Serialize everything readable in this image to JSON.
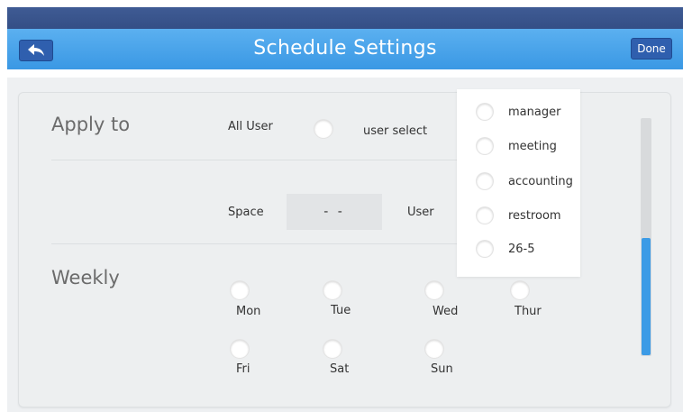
{
  "header": {
    "title": "Schedule Settings",
    "back_icon": "back-arrow-icon",
    "done_label": "Done"
  },
  "apply_to": {
    "label": "Apply to",
    "all_user_label": "All User",
    "user_select_label": "user select"
  },
  "space_user": {
    "space_label": "Space",
    "space_value": "- -",
    "user_label": "User"
  },
  "user_dropdown": {
    "options": [
      "manager",
      "meeting",
      "accounting",
      "restroom",
      "26-5"
    ]
  },
  "weekly": {
    "label": "Weekly",
    "days": [
      "Mon",
      "Tue",
      "Wed",
      "Thur",
      "Fri",
      "Sat",
      "Sun"
    ]
  },
  "colors": {
    "header": "#4aa5ec",
    "topbar": "#3a5590",
    "button": "#2f5fae",
    "scroll_thumb": "#3c9be6"
  }
}
